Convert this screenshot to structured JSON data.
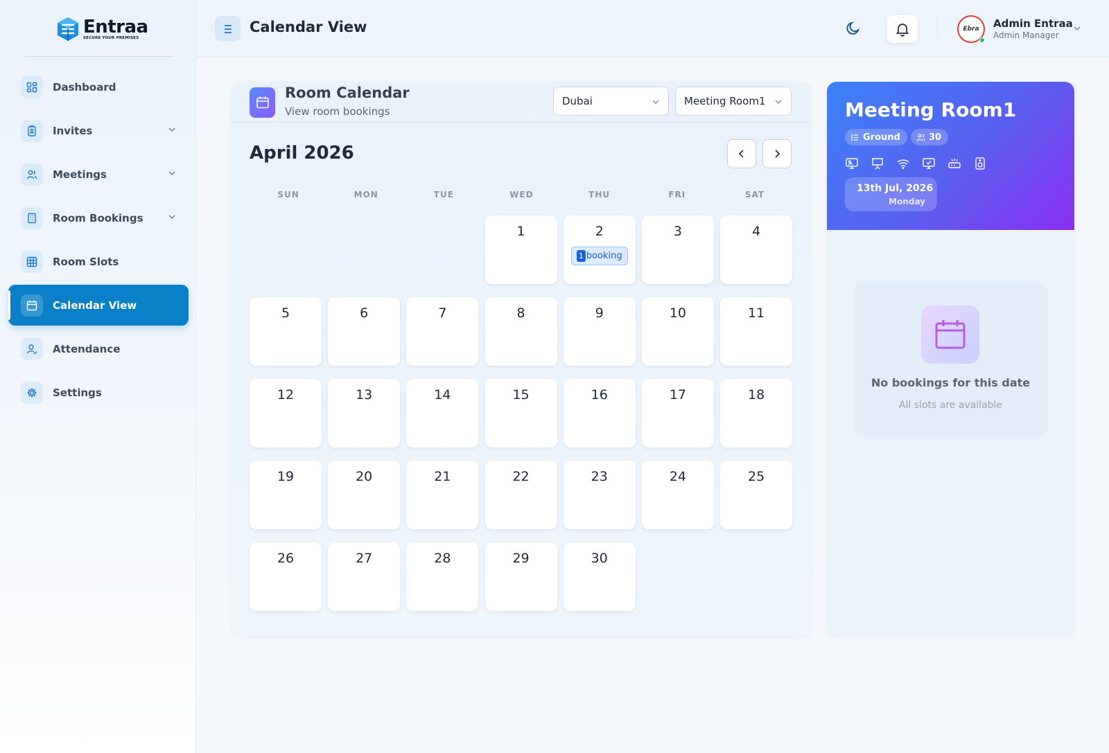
{
  "brand": {
    "name": "Entraa",
    "tagline": "SECURE YOUR PREMISES"
  },
  "sidebar": {
    "items": [
      {
        "label": "Dashboard",
        "icon": "dashboard-icon",
        "has_submenu": false,
        "active": false
      },
      {
        "label": "Invites",
        "icon": "badge-icon",
        "has_submenu": true,
        "active": false
      },
      {
        "label": "Meetings",
        "icon": "users-icon",
        "has_submenu": true,
        "active": false
      },
      {
        "label": "Room Bookings",
        "icon": "building-icon",
        "has_submenu": true,
        "active": false
      },
      {
        "label": "Room Slots",
        "icon": "grid-icon",
        "has_submenu": false,
        "active": false
      },
      {
        "label": "Calendar View",
        "icon": "calendar-icon",
        "has_submenu": false,
        "active": true
      },
      {
        "label": "Attendance",
        "icon": "user-check-icon",
        "has_submenu": false,
        "active": false
      },
      {
        "label": "Settings",
        "icon": "gear-icon",
        "has_submenu": false,
        "active": false
      }
    ]
  },
  "header": {
    "title": "Calendar View",
    "user": {
      "name": "Admin Entraa",
      "role": "Admin Manager",
      "avatar_text": "Ebra",
      "online": true
    }
  },
  "calendar": {
    "title": "Room Calendar",
    "subtitle": "View room bookings",
    "location_select": "Dubai",
    "room_select": "Meeting Room1",
    "month_label": "April 2026",
    "weekdays": [
      "SUN",
      "MON",
      "TUE",
      "WED",
      "THU",
      "FRI",
      "SAT"
    ],
    "leading_blanks": 3,
    "days": [
      {
        "n": "1"
      },
      {
        "n": "2",
        "booking_count": "1",
        "booking_label": "booking"
      },
      {
        "n": "3"
      },
      {
        "n": "4"
      },
      {
        "n": "5"
      },
      {
        "n": "6"
      },
      {
        "n": "7"
      },
      {
        "n": "8"
      },
      {
        "n": "9"
      },
      {
        "n": "10"
      },
      {
        "n": "11"
      },
      {
        "n": "12"
      },
      {
        "n": "13"
      },
      {
        "n": "14"
      },
      {
        "n": "15"
      },
      {
        "n": "16"
      },
      {
        "n": "17"
      },
      {
        "n": "18"
      },
      {
        "n": "19"
      },
      {
        "n": "20"
      },
      {
        "n": "21"
      },
      {
        "n": "22"
      },
      {
        "n": "23"
      },
      {
        "n": "24"
      },
      {
        "n": "25"
      },
      {
        "n": "26"
      },
      {
        "n": "27"
      },
      {
        "n": "28"
      },
      {
        "n": "29"
      },
      {
        "n": "30"
      }
    ]
  },
  "room": {
    "name": "Meeting Room1",
    "floor": "Ground",
    "capacity": "30",
    "amenities": [
      "tv-icon",
      "projector-icon",
      "wifi-icon",
      "monitor-icon",
      "whiteboard-icon",
      "speaker-icon"
    ],
    "selected_date": "13th Jul, 2026",
    "selected_weekday": "Monday",
    "empty_title": "No bookings for this date",
    "empty_subtitle": "All slots are available"
  },
  "colors": {
    "accent": "#0a80c8",
    "room_gradient_start": "#3b82f6",
    "room_gradient_end": "#8b2ff2",
    "badge": "#1d5fd6"
  }
}
